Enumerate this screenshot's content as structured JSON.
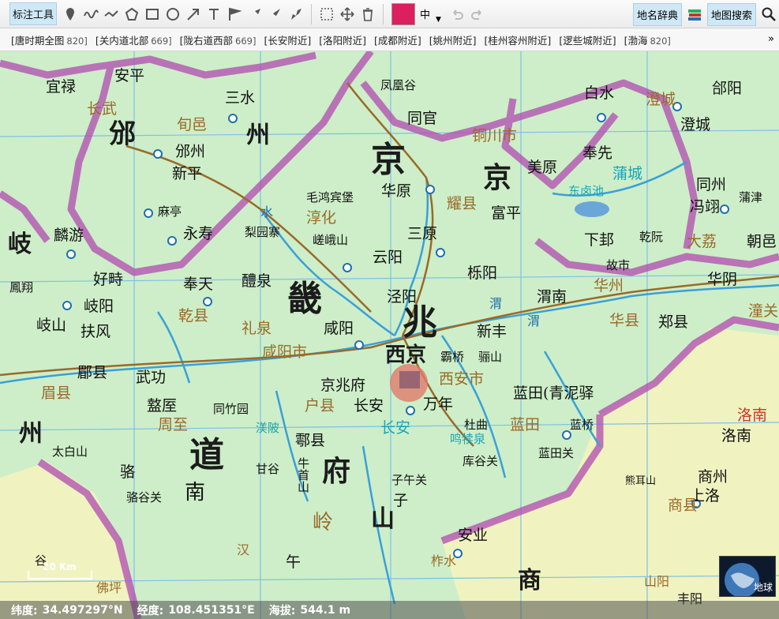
{
  "toolbar": {
    "annotate_label": "标注工具",
    "size_value": "中",
    "dict_label": "地名辞典",
    "search_label": "地图搜索",
    "color": "#dc1f5e"
  },
  "bookmarks": [
    {
      "label": "[唐时期全图",
      "num": "820]"
    },
    {
      "label": "[关内道北部",
      "num": "669]"
    },
    {
      "label": "[陇右道西部",
      "num": "669]"
    },
    {
      "label": "[长安附近]",
      "num": ""
    },
    {
      "label": "[洛阳附近]",
      "num": ""
    },
    {
      "label": "[成都附近]",
      "num": ""
    },
    {
      "label": "[姚州附近]",
      "num": ""
    },
    {
      "label": "[桂州容州附近]",
      "num": ""
    },
    {
      "label": "[逻些城附近]",
      "num": ""
    },
    {
      "label": "[渤海",
      "num": "820]"
    }
  ],
  "bookmarks_more": "»",
  "map": {
    "scale_label": "20 Km",
    "globe_label": "地球",
    "colors": {
      "land": "#cdeec8",
      "land_south": "#f0f3bf",
      "river": "#3aa0d8",
      "border": "#b24ab0",
      "road": "#9a6a2a"
    },
    "labels": {
      "l1": "宜禄",
      "l2": "安平",
      "l3": "长武",
      "l4": "三水",
      "l5": "凤凰谷",
      "l6": "白水",
      "l7": "澄城",
      "l8": "郃阳",
      "l9": "邠",
      "l10": "旬邑",
      "l11": "州",
      "l12": "邠州",
      "l13": "新平",
      "l14": "同官",
      "l15": "铜川市",
      "l16": "奉先",
      "l17": "澄城",
      "l18": "京",
      "l19": "京",
      "l20": "美原",
      "l21": "蒲城",
      "l22": "同州",
      "l23": "冯翊",
      "l24": "华原",
      "l25": "耀县",
      "l26": "富平",
      "l27": "东卤池",
      "l28": "毛鸿宾堡",
      "l29": "淳化",
      "l30": "麻亭",
      "l31": "永寿",
      "l32": "梨园寨",
      "l33": "嵯峨山",
      "l34": "三原",
      "l35": "下邽",
      "l36": "乾阮",
      "l37": "大荔",
      "l38": "麟游",
      "l39": "岐",
      "l40": "云阳",
      "l41": "栎阳",
      "l42": "故市",
      "l43": "华州",
      "l44": "华阴",
      "l45": "好畤",
      "l46": "奉天",
      "l47": "醴泉",
      "l48": "畿",
      "l49": "泾阳",
      "l50": "渭南",
      "l51": "岐阳",
      "l52": "乾县",
      "l53": "礼泉",
      "l54": "咸阳",
      "l55": "兆",
      "l56": "新丰",
      "l57": "华县",
      "l58": "郑县",
      "l59": "扶风",
      "l60": "岐山",
      "l61": "咸阳市",
      "l62": "西京",
      "l63": "霸桥",
      "l64": "骊山",
      "l65": "郿县",
      "l66": "武功",
      "l67": "京兆府",
      "l68": "西安市",
      "l69": "蓝田(青泥驿",
      "l70": "盩厔",
      "l71": "同竹园",
      "l72": "户县",
      "l73": "长安",
      "l74": "万年",
      "l75": "杜曲",
      "l76": "周至",
      "l77": "渼陂",
      "l78": "鄠县",
      "l79": "长安",
      "l80": "鸣犊泉",
      "l81": "蓝田",
      "l82": "蓝桥",
      "l83": "洛南",
      "l84": "太白山",
      "l85": "道",
      "l86": "库谷关",
      "l87": "蓝田关",
      "l88": "熊耳山",
      "l89": "商州",
      "l90": "上洛",
      "l91": "甘谷",
      "l92": "府",
      "l93": "子午关",
      "l94": "牛首山",
      "l95": "南",
      "l96": "骆谷关",
      "l97": "骆",
      "l98": "子",
      "l99": "商县",
      "l100": "山",
      "l101": "岭",
      "l102": "安业",
      "l103": "柞水",
      "l104": "谷",
      "l105": "午",
      "l106": "汉",
      "l107": "商",
      "l108": "佛坪",
      "l109": "山阳",
      "l110": "丰阳",
      "l111": "眉县",
      "l112": "州",
      "l113": "鳳翔",
      "l114": "洛南",
      "l115": "蒲津",
      "l116": "朝邑",
      "l117": "潼关",
      "l118": "水",
      "l119": "渭",
      "l120": "渭"
    }
  },
  "status": {
    "lat_label": "纬度:",
    "lat_value": "34.497297°N",
    "lon_label": "经度:",
    "lon_value": "108.451351°E",
    "alt_label": "海拔:",
    "alt_value": "544.1 m"
  }
}
